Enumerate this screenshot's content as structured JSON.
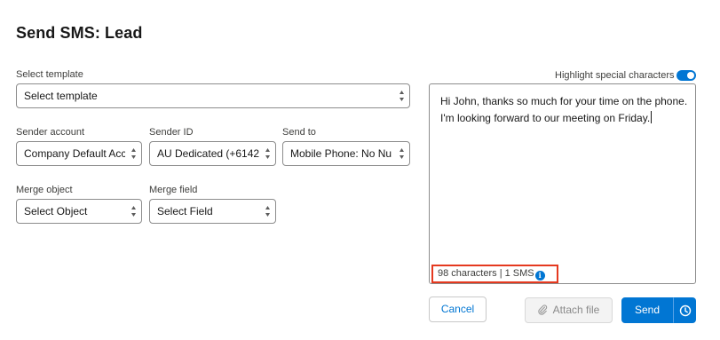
{
  "dialog": {
    "title": "Send SMS: Lead"
  },
  "template": {
    "label": "Select template",
    "value": "Select template"
  },
  "sender_account": {
    "label": "Sender account",
    "value": "Company Default Acc"
  },
  "sender_id": {
    "label": "Sender ID",
    "value": "AU Dedicated (+6142"
  },
  "send_to": {
    "label": "Send to",
    "value": "Mobile Phone: No Nu"
  },
  "merge_object": {
    "label": "Merge object",
    "value": "Select Object"
  },
  "merge_field": {
    "label": "Merge field",
    "value": "Select Field"
  },
  "highlight": {
    "label": "Highlight special characters",
    "enabled": true
  },
  "message": {
    "line1": "Hi John, thanks so much for your time on the phone.",
    "line2": "I'm looking forward to our meeting on Friday.",
    "char_count": "98 characters | 1 SMS",
    "info_glyph": "i"
  },
  "buttons": {
    "cancel": "Cancel",
    "attach": "Attach file",
    "send": "Send"
  },
  "colors": {
    "brand": "#0176d3",
    "highlight_box": "#e5391f"
  },
  "icons": {
    "toggle": "toggle-on-icon",
    "info": "info-icon",
    "attach": "paperclip-icon",
    "schedule": "clock-icon",
    "select": "updown-arrows-icon"
  }
}
